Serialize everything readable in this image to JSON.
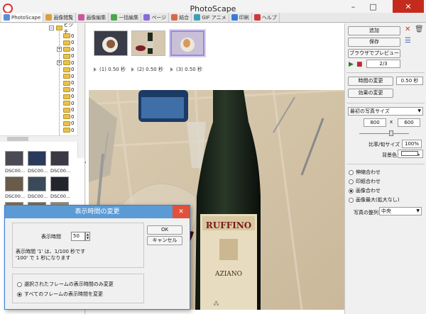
{
  "window": {
    "title": "PhotoScape"
  },
  "tabs": [
    {
      "label": "PhotoScape",
      "color": "#5a8fd8"
    },
    {
      "label": "画像閲覧",
      "color": "#d8a040"
    },
    {
      "label": "画像編集",
      "color": "#c85a9a"
    },
    {
      "label": "一括編集",
      "color": "#4aa84a"
    },
    {
      "label": "ページ",
      "color": "#8a6ad8"
    },
    {
      "label": "結合",
      "color": "#d86a4a"
    },
    {
      "label": "GIF アニメ",
      "color": "#3aa0b8"
    },
    {
      "label": "印刷",
      "color": "#3a7ad8"
    },
    {
      "label": "ヘルプ",
      "color": "#d03a3a"
    }
  ],
  "folder_tree": {
    "root_label": "ピクチ",
    "nodes": [
      "0",
      "0",
      "0",
      "0",
      "0",
      "0",
      "0",
      "0",
      "0",
      "0",
      "0",
      "0",
      "0",
      "0",
      "0"
    ]
  },
  "thumbnails": [
    {
      "label": "DSC00...",
      "color": "#4a4a55"
    },
    {
      "label": "DSC00...",
      "color": "#2a3a5a"
    },
    {
      "label": "DSC00...",
      "color": "#3a3a44"
    },
    {
      "label": "DSC00...",
      "color": "#6a5a4a"
    },
    {
      "label": "DSC00...",
      "color": "#3a4a5a"
    },
    {
      "label": "DSC00...",
      "color": "#22252c"
    },
    {
      "label": "DSC00...",
      "color": "#8a6a4a"
    },
    {
      "label": "DSC00...",
      "color": "#7a6a55"
    },
    {
      "label": "DSC00...",
      "color": "#9a8a70"
    }
  ],
  "frames": [
    {
      "caption": "(1) 0.50 秒"
    },
    {
      "caption": "(2) 0.50 秒"
    },
    {
      "caption": "(3) 0.50 秒"
    }
  ],
  "right_panel": {
    "add_label": "追加",
    "save_label": "保存",
    "preview_label": "ブラウザでプレビュー",
    "frame_counter": "2/3",
    "change_time_label": "時間の変更",
    "time_value": "0.50 秒",
    "change_effect_label": "効果の変更",
    "photo_size_option": "最初の写真サイズ",
    "width_value": "800",
    "size_sep": "x",
    "height_value": "600",
    "ratio_label": "比率/旬サイズ",
    "ratio_value": "100%",
    "bgcolor_label": "背景色",
    "fit_options": [
      {
        "label": "伸縮合わせ",
        "checked": false
      },
      {
        "label": "印紙合わせ",
        "checked": false
      },
      {
        "label": "画像合わせ",
        "checked": true
      },
      {
        "label": "画像最大(拡大なし)",
        "checked": false
      }
    ],
    "align_label": "写真の整列",
    "align_value": "中央"
  },
  "dialog": {
    "title": "表示時間の変更",
    "time_label": "表示時間",
    "time_value": "50",
    "note_line1": "表示時間 '1' は、1/100 秒です",
    "note_line2": "'100' で 1 秒になります",
    "ok_label": "OK",
    "cancel_label": "キャンセル",
    "options": [
      {
        "label": "選択されたフレームの表示時間のみ変更",
        "checked": false
      },
      {
        "label": "すべてのフレームの表示時間を変更",
        "checked": true
      }
    ]
  }
}
